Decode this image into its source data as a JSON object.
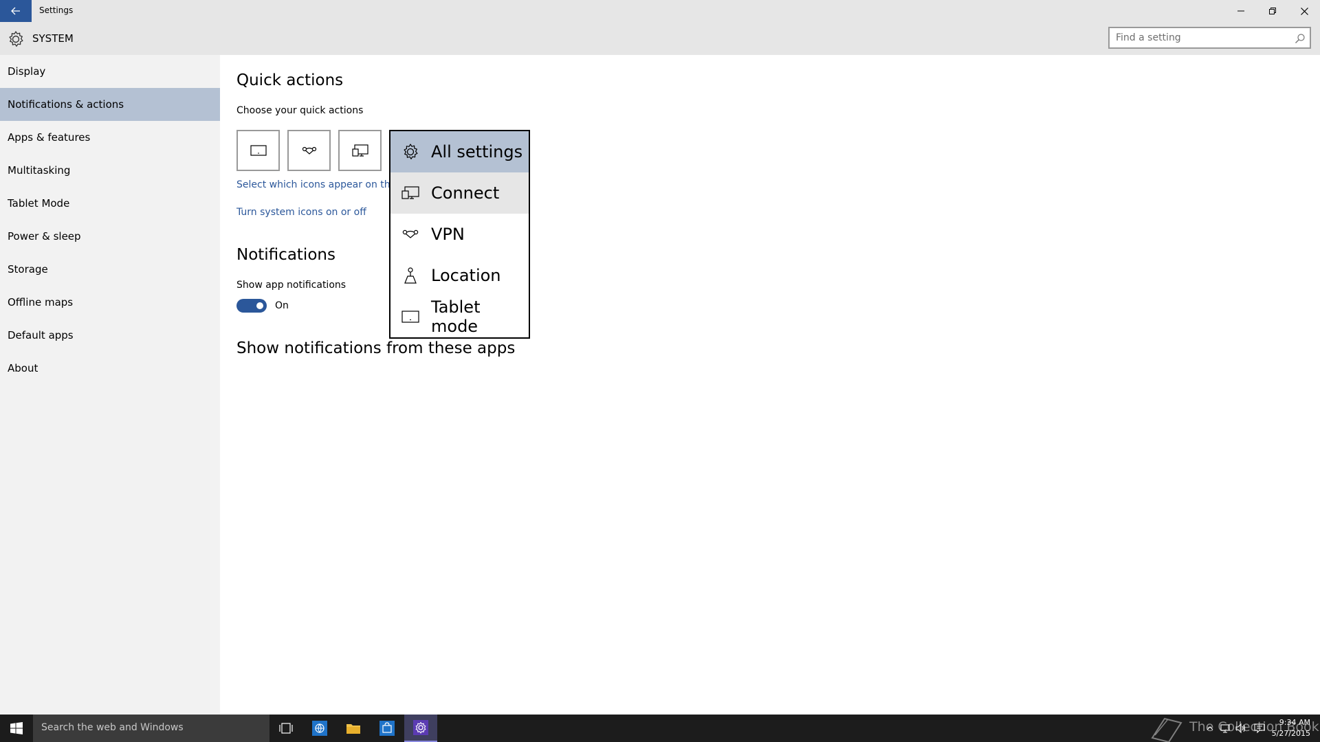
{
  "window": {
    "title": "Settings",
    "back_icon": "back-arrow-icon",
    "min_icon": "minimize-icon",
    "max_icon": "restore-icon",
    "close_icon": "close-icon"
  },
  "header": {
    "title": "SYSTEM",
    "icon": "gear-icon",
    "search_placeholder": "Find a setting"
  },
  "sidebar": {
    "items": [
      {
        "label": "Display"
      },
      {
        "label": "Notifications & actions",
        "selected": true
      },
      {
        "label": "Apps & features"
      },
      {
        "label": "Multitasking"
      },
      {
        "label": "Tablet Mode"
      },
      {
        "label": "Power & sleep"
      },
      {
        "label": "Storage"
      },
      {
        "label": "Offline maps"
      },
      {
        "label": "Default apps"
      },
      {
        "label": "About"
      }
    ]
  },
  "main": {
    "quick_actions_title": "Quick actions",
    "quick_actions_subtitle": "Choose your quick actions",
    "select_icons_link": "Select which icons appear on the",
    "system_icons_link": "Turn system icons on or off",
    "notifications_title": "Notifications",
    "show_app_notifications_label": "Show app notifications",
    "toggle_state": "On",
    "apps_title": "Show notifications from these apps"
  },
  "flyout": {
    "items": [
      {
        "label": "All settings",
        "icon": "gear-icon"
      },
      {
        "label": "Connect",
        "icon": "connect-icon"
      },
      {
        "label": "VPN",
        "icon": "vpn-icon"
      },
      {
        "label": "Location",
        "icon": "location-icon"
      },
      {
        "label": "Tablet mode",
        "icon": "tablet-icon"
      }
    ]
  },
  "taskbar": {
    "search_placeholder": "Search the web and Windows",
    "watermark": "The Collection Book",
    "time": "9:34 AM",
    "date": "5/27/2015"
  },
  "colors": {
    "accent": "#2b579a",
    "selected_nav": "#b4c1d3",
    "chrome": "#e6e6e6",
    "sidebar": "#f2f2f2",
    "taskbar": "#1c1c1c"
  }
}
